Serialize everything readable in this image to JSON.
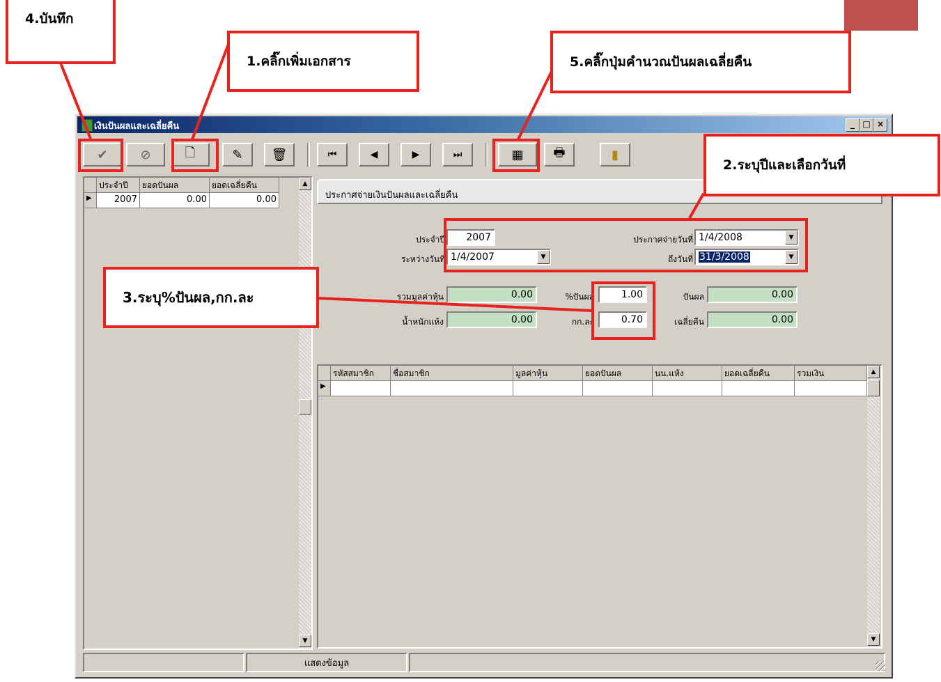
{
  "page_badge": "",
  "callouts": {
    "save": "4.บันทึก",
    "add_doc": "1.คลิ๊กเพิ่มเอกสาร",
    "calc": "5.คลิ๊กปุ่มคำนวณปันผลเฉลี่ยคืน",
    "year_date": "2.ระบุปีและเลือกวันที่",
    "percent": "3.ระบุ%ปันผล,กก.ละ"
  },
  "window": {
    "title": "เงินปันผลและเฉลี่ยคืน",
    "min": "_",
    "max": "□",
    "close": "×"
  },
  "toolbar": [
    {
      "name": "save-icon",
      "glyph": "✔"
    },
    {
      "name": "cancel-icon",
      "glyph": "⊘"
    },
    {
      "name": "new-document-icon",
      "glyph": "🗋"
    },
    {
      "name": "edit-document-icon",
      "glyph": "✎"
    },
    {
      "name": "delete-icon",
      "glyph": "🗑"
    },
    {
      "name": "first-record-icon",
      "glyph": "⏮"
    },
    {
      "name": "prev-record-icon",
      "glyph": "◀"
    },
    {
      "name": "next-record-icon",
      "glyph": "▶"
    },
    {
      "name": "last-record-icon",
      "glyph": "⏭"
    },
    {
      "name": "calculator-icon",
      "glyph": "▦"
    },
    {
      "name": "printer-icon",
      "glyph": "🖶"
    },
    {
      "name": "exit-icon",
      "glyph": "▮"
    }
  ],
  "left_grid": {
    "headers": [
      "ประจำปี",
      "ยอดปันผล",
      "ยอดเฉลี่ยคืน"
    ],
    "rows": [
      [
        "2007",
        "0.00",
        "0.00"
      ]
    ]
  },
  "panel_title": "ประกาศจ่ายเงินปันผลและเฉลี่ยคืน",
  "form": {
    "year_label": "ประจำปี",
    "year_value": "2007",
    "announce_label": "ประกาศจ่ายวันที่",
    "announce_value": "1/4/2008",
    "between_label": "ระหว่างวันที่",
    "between_value": "1/4/2007",
    "to_label": "ถึงวันที่",
    "to_value": "31/3/2008",
    "total_share_label": "รวมมูลค่าหุ้น",
    "total_share_value": "0.00",
    "pct_dividend_label": "%ปันผล",
    "pct_dividend_value": "1.00",
    "dividend_label": "ปันผล",
    "dividend_value": "0.00",
    "dry_weight_label": "น้ำหนักแห้ง",
    "dry_weight_value": "0.00",
    "per_kg_label": "กก.ละ",
    "per_kg_value": "0.70",
    "avg_return_label": "เฉลี่ยคืน",
    "avg_return_value": "0.00"
  },
  "member_grid": {
    "headers": [
      "รหัสสมาชิก",
      "ชื่อสมาชิก",
      "มูลค่าหุ้น",
      "ยอดปันผล",
      "นน.แห้ง",
      "ยอดเฉลี่ยคืน",
      "รวมเงิน"
    ]
  },
  "status": {
    "cell1": "",
    "cell2": "แสดงข้อมูล",
    "cell3": ""
  }
}
